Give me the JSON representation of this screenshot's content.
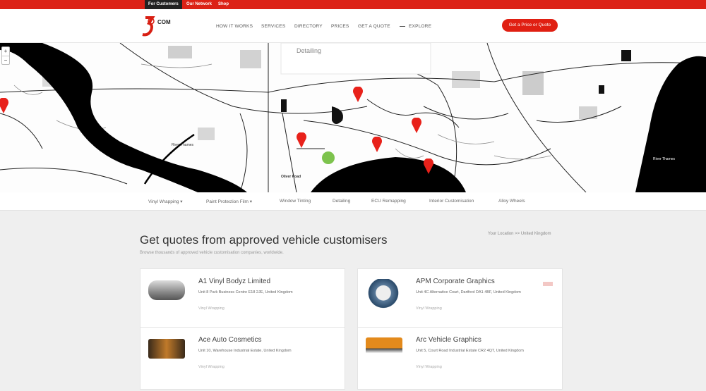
{
  "topbar": {
    "tabs": [
      "For Customers",
      "Our Network",
      "Shop"
    ],
    "color": "#dc2216"
  },
  "header": {
    "logo_text": "COM",
    "nav": [
      "HOW IT WORKS",
      "SERVICES",
      "DIRECTORY",
      "PRICES",
      "GET A QUOTE",
      "EXPLORE"
    ],
    "cta_label": "Get a Price or Quote"
  },
  "map": {
    "zoom_in": "+",
    "zoom_out": "−",
    "labels": [
      "River Thames",
      "River Thames",
      "Oliver Road"
    ],
    "popup_title": "Detailing",
    "pin_color": "#e8211a"
  },
  "categories": [
    "Vinyl Wrapping",
    "Paint Protection Film",
    "Window Tinting",
    "Detailing",
    "ECU Remapping",
    "Interior Customisation",
    "Alloy Wheels"
  ],
  "main": {
    "title": "Get quotes from approved vehicle customisers",
    "subtitle": "Browse thousands of approved vehicle customisation companies, worldwide.",
    "location": "Your Location >> United Kingdom"
  },
  "listings": [
    {
      "name": "A1 Vinyl Bodyz Limited",
      "address": "Unit 8 Park Business Centre E18 2JE, United Kingdom",
      "tag": "Vinyl Wrapping"
    },
    {
      "name": "Ace Auto Cosmetics",
      "address": "Unit 10, Warehouse Industrial Estate, United Kingdom",
      "tag": "Vinyl Wrapping"
    },
    {
      "name": "APM Corporate Graphics",
      "address": "Unit 4C Alternative Court, Dartford DA1 4BF, United Kingdom",
      "tag": "Vinyl Wrapping"
    },
    {
      "name": "Arc Vehicle Graphics",
      "address": "Unit 5, Court Road Industrial Estate CR2 4QT, United Kingdom",
      "tag": "Vinyl Wrapping"
    }
  ]
}
